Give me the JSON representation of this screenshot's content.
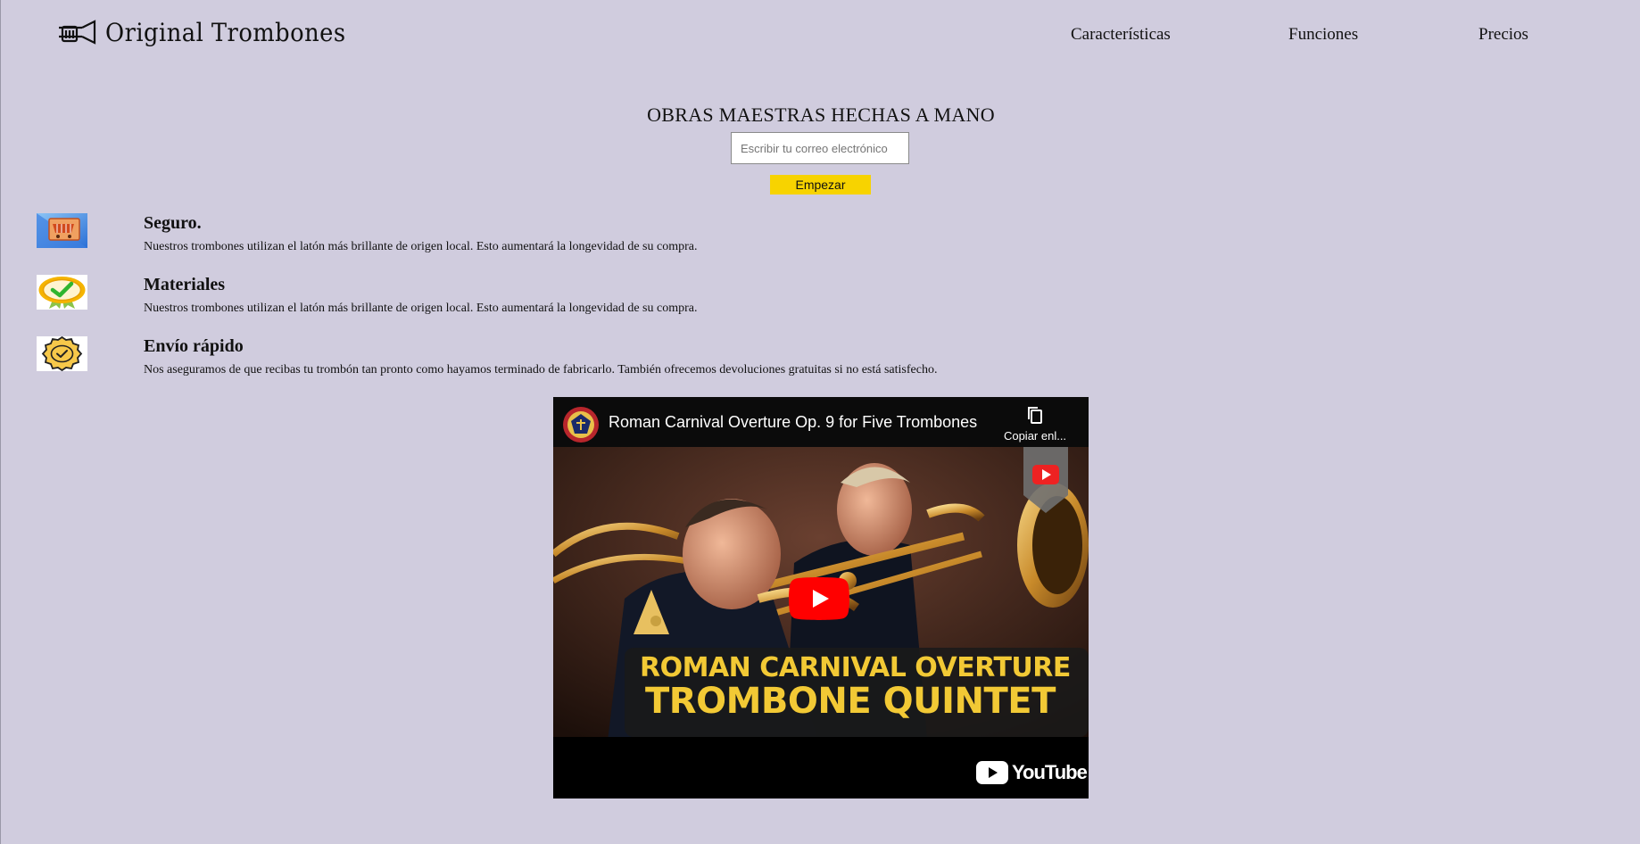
{
  "header": {
    "brand": "Original Trombones",
    "nav": [
      "Características",
      "Funciones",
      "Precios"
    ]
  },
  "hero": {
    "title": "OBRAS MAESTRAS HECHAS A MANO",
    "email_placeholder": "Escribir tu correo electrónico",
    "cta_label": "Empezar"
  },
  "features": [
    {
      "icon": "shopping-cart-icon",
      "title": "Seguro.",
      "text": "Nuestros trombones utilizan el latón más brillante de origen local. Esto aumentará la longevidad de su compra."
    },
    {
      "icon": "quality-badge-icon",
      "title": "Materiales",
      "text": "Nuestros trombones utilizan el latón más brillante de origen local. Esto aumentará la longevidad de su compra."
    },
    {
      "icon": "verified-seal-icon",
      "title": "Envío rápido",
      "text": "Nos aseguramos de que recibas tu trombón tan pronto como hayamos terminado de fabricarlo. También ofrecemos devoluciones gratuitas si no está satisfecho."
    }
  ],
  "video": {
    "title": "Roman Carnival Overture Op. 9 for Five Trombones",
    "copy_link_label": "Copiar enl...",
    "banner_line1": "ROMAN CARNIVAL OVERTURE",
    "banner_line2": "TROMBONE QUINTET",
    "brand": "YouTube"
  },
  "colors": {
    "background": "#d0ccde",
    "cta": "#f7d300",
    "youtube_red": "#ff0000",
    "banner_text": "#f2c935"
  }
}
